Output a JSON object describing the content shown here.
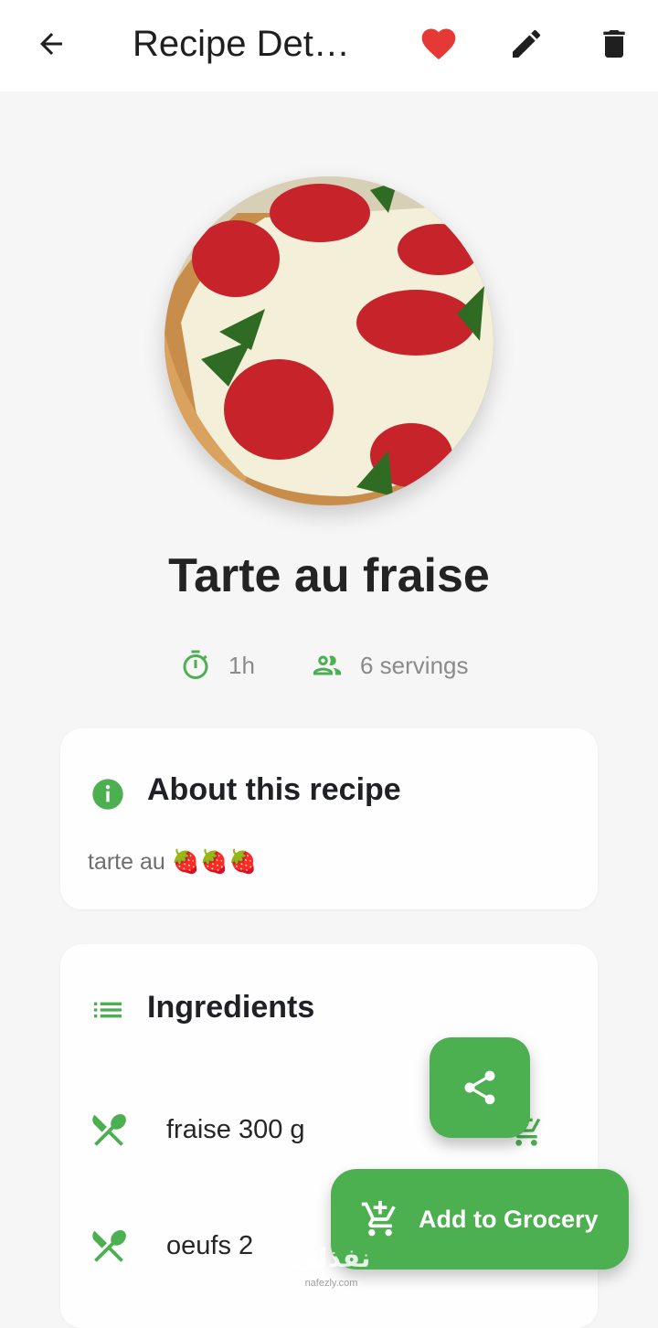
{
  "appbar": {
    "title": "Recipe Det…",
    "back_icon": "arrow-left-icon",
    "favorite_icon": "heart-icon",
    "edit_icon": "pencil-icon",
    "delete_icon": "trash-icon"
  },
  "recipe": {
    "name": "Tarte au fraise",
    "time": "1h",
    "servings": "6 servings"
  },
  "about": {
    "heading": "About this recipe",
    "description": "tarte au 🍓🍓🍓"
  },
  "ingredients": {
    "heading": "Ingredients",
    "items": [
      {
        "label": "fraise 300 g"
      },
      {
        "label": "oeufs  2"
      }
    ]
  },
  "actions": {
    "add_to_grocery": "Add to Grocery"
  },
  "watermark": {
    "brand": "نفذلي",
    "url": "nafezly.com"
  },
  "colors": {
    "accent": "#4caf50",
    "favorite": "#e53935",
    "background": "#f6f6f7"
  }
}
